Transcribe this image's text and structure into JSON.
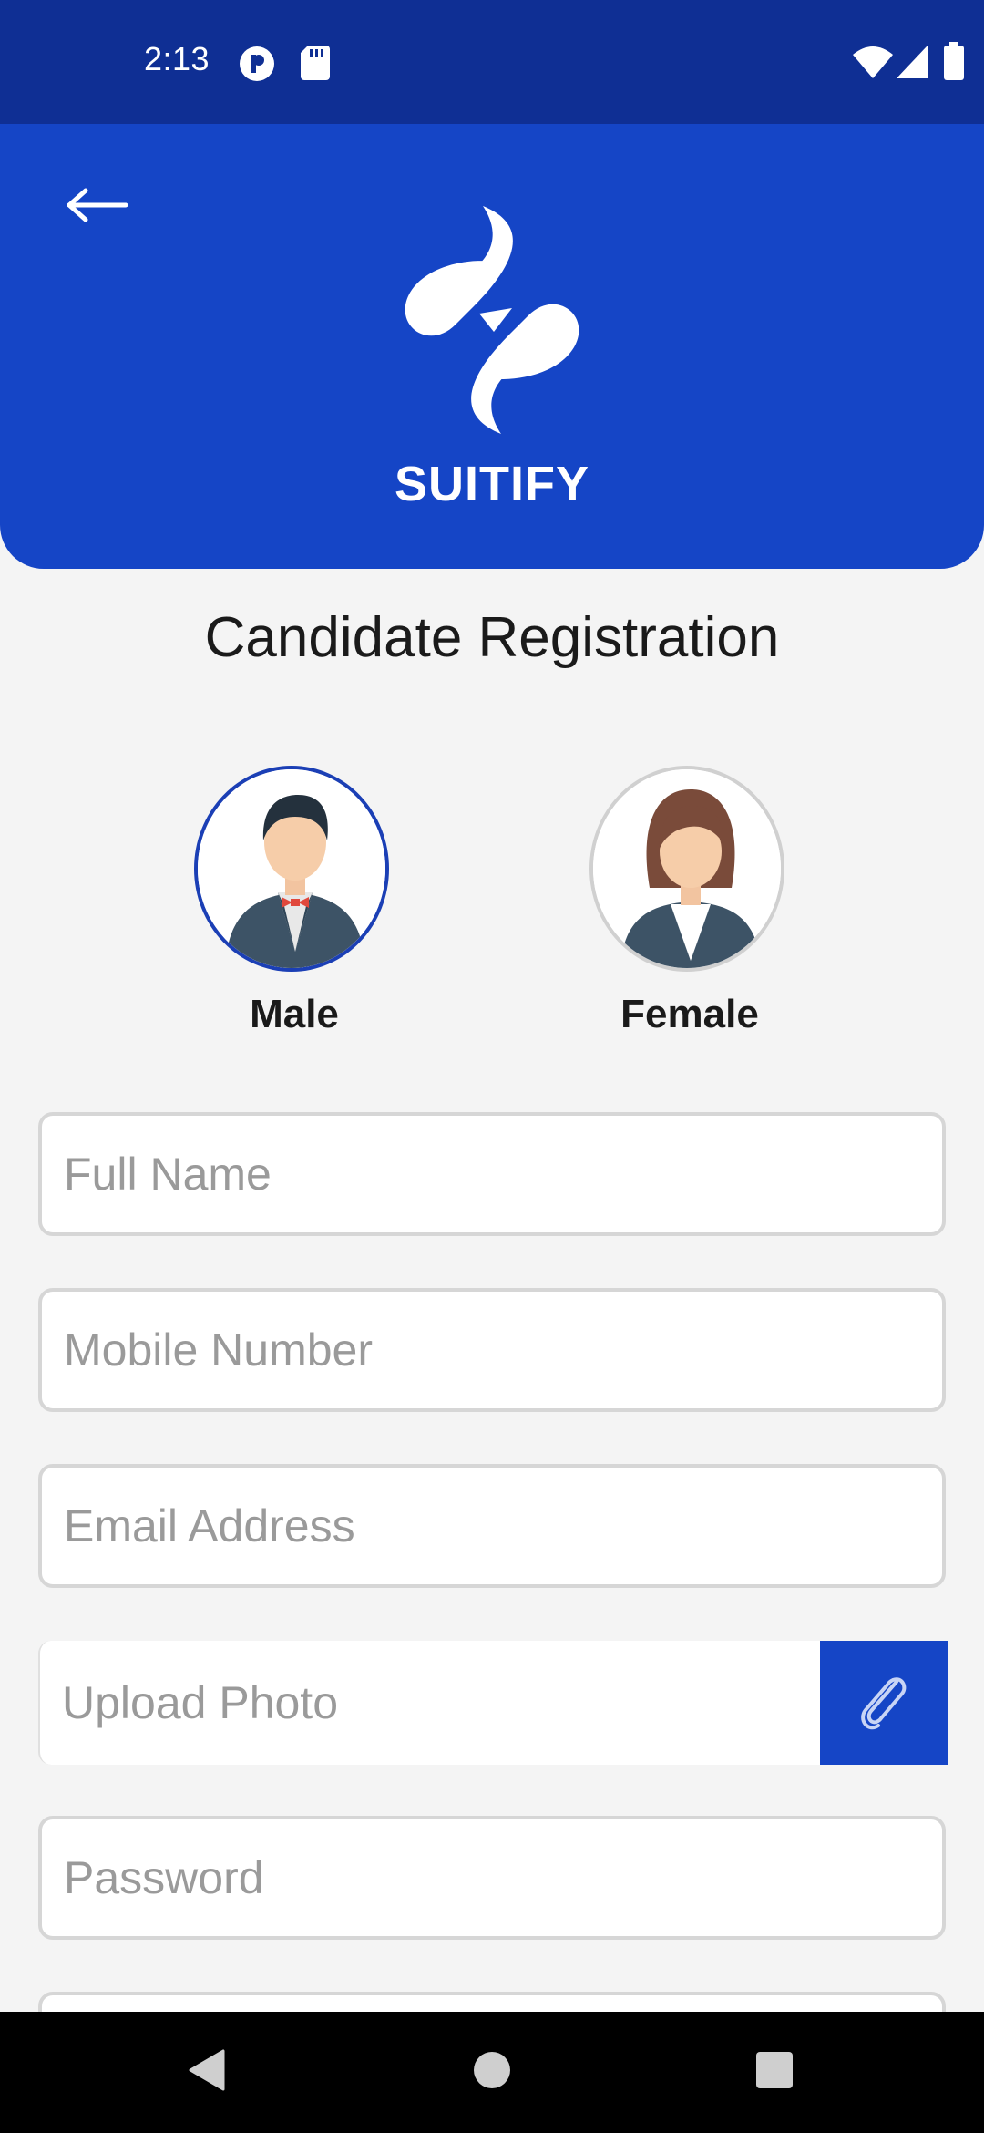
{
  "status_bar": {
    "time": "2:13",
    "icons": [
      "notification-p-icon",
      "sd-card-icon",
      "wifi-icon",
      "cell-signal-icon",
      "battery-icon"
    ]
  },
  "header": {
    "back_icon": "arrow-left-icon",
    "brand_name": "SUITIFY",
    "color": "#1545c6"
  },
  "page": {
    "title": "Candidate Registration"
  },
  "gender": {
    "selected": "male",
    "options": [
      {
        "id": "male",
        "label": "Male"
      },
      {
        "id": "female",
        "label": "Female"
      }
    ]
  },
  "form": {
    "full_name": {
      "placeholder": "Full Name",
      "value": ""
    },
    "mobile": {
      "placeholder": "Mobile Number",
      "value": ""
    },
    "email": {
      "placeholder": "Email Address",
      "value": ""
    },
    "photo": {
      "placeholder": "Upload Photo",
      "value": "",
      "button_icon": "paperclip-icon"
    },
    "password": {
      "placeholder": "Password",
      "value": ""
    }
  },
  "nav_bar": {
    "icons": [
      "back-triangle-icon",
      "home-circle-icon",
      "recents-square-icon"
    ]
  },
  "colors": {
    "status_bar": "#0f2f94",
    "primary": "#1545c6",
    "background": "#f4f4f4"
  }
}
